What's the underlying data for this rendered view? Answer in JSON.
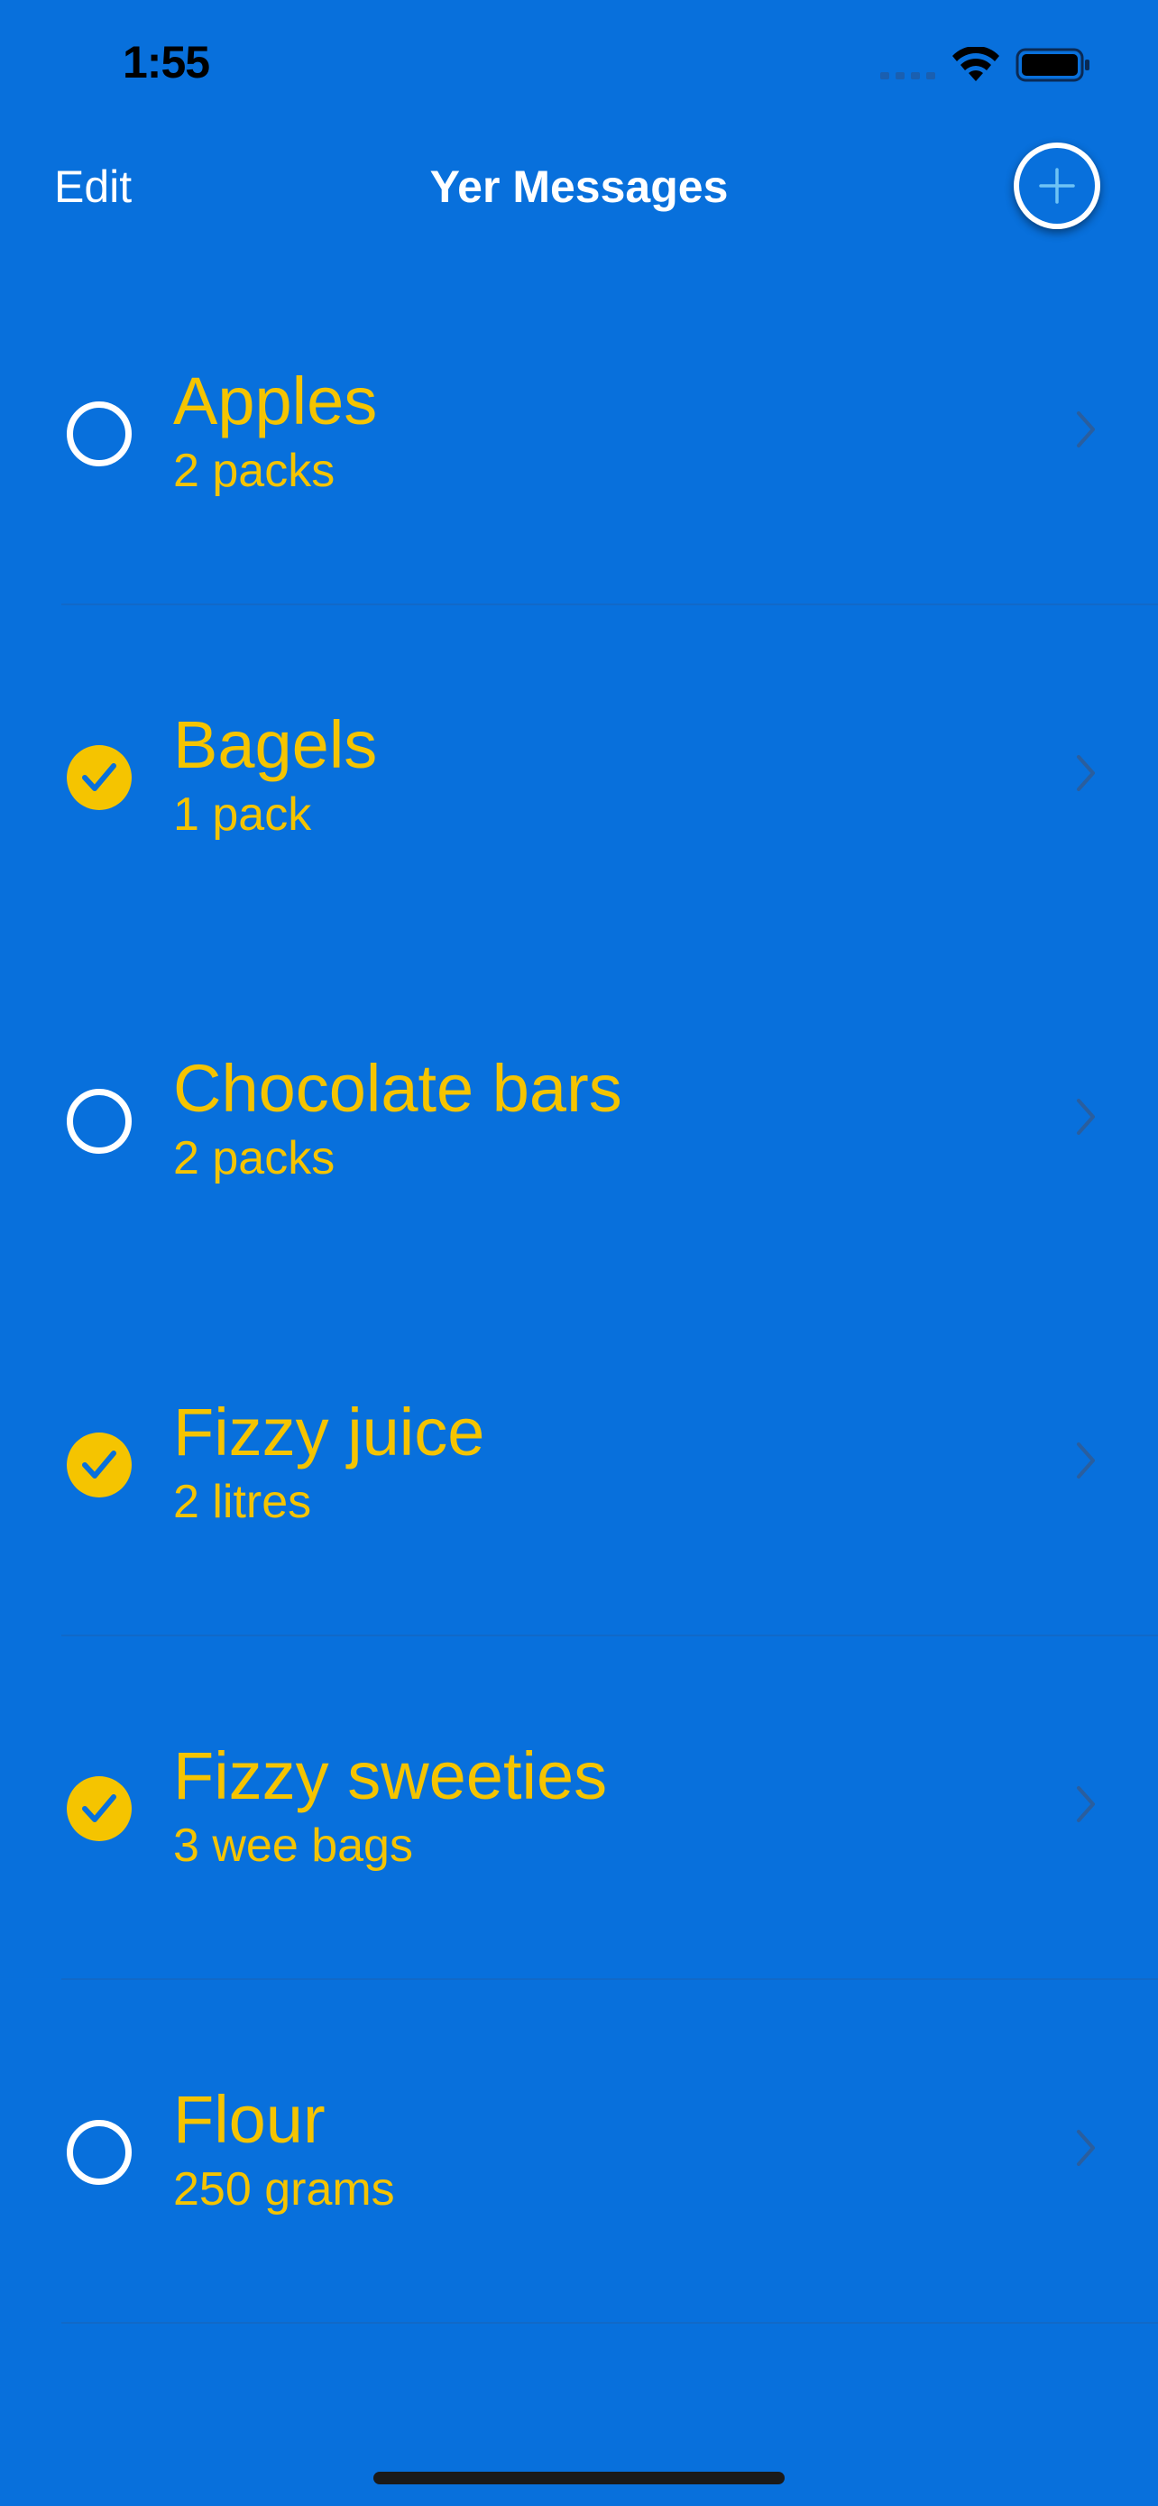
{
  "status_bar": {
    "time": "1:55",
    "icons": [
      "signal-icon",
      "wifi-icon",
      "battery-icon"
    ]
  },
  "nav": {
    "edit_label": "Edit",
    "title": "Yer Messages",
    "add_icon": "plus-icon"
  },
  "colors": {
    "background": "#0870DC",
    "accent": "#F5C400",
    "text_light": "#FFFFFF"
  },
  "items": [
    {
      "title": "Apples",
      "subtitle": "2 packs",
      "checked": false
    },
    {
      "title": "Bagels",
      "subtitle": "1 pack",
      "checked": true
    },
    {
      "title": "Chocolate bars",
      "subtitle": "2 packs",
      "checked": false
    },
    {
      "title": "Fizzy juice",
      "subtitle": "2 litres",
      "checked": true
    },
    {
      "title": "Fizzy sweeties",
      "subtitle": "3 wee bags",
      "checked": true
    },
    {
      "title": "Flour",
      "subtitle": "250 grams",
      "checked": false
    }
  ]
}
